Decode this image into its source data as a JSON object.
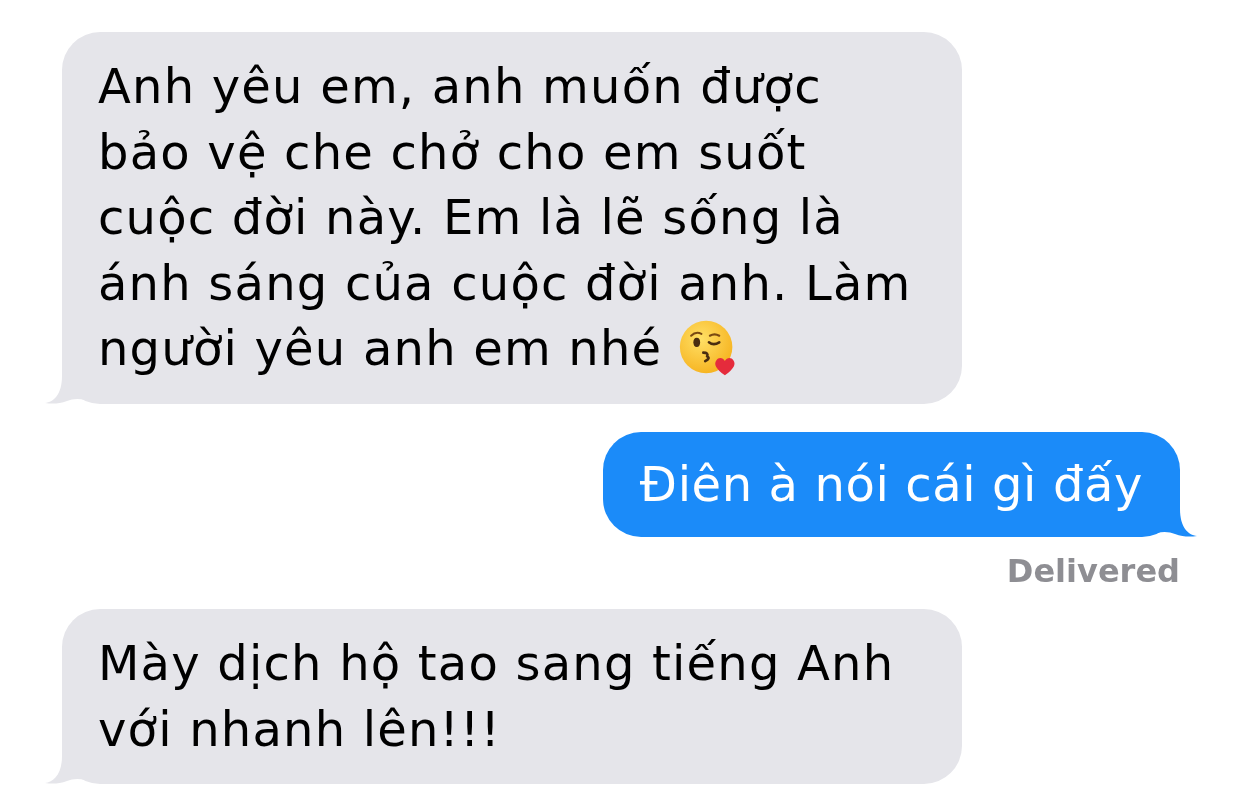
{
  "messages": [
    {
      "kind": "received",
      "text": "Anh yêu em, anh muốn được bảo vệ che chở cho em suốt cuộc đời này. Em là lẽ sống là ánh sáng của cuộc đời anh. Làm người yêu anh em nhé",
      "emoji": true
    },
    {
      "kind": "sent",
      "text": "Điên à nói cái gì đấy",
      "emoji": false,
      "status": "Delivered"
    },
    {
      "kind": "received",
      "text": "Mày dịch hộ tao sang tiếng Anh với nhanh lên!!!",
      "emoji": false
    }
  ]
}
